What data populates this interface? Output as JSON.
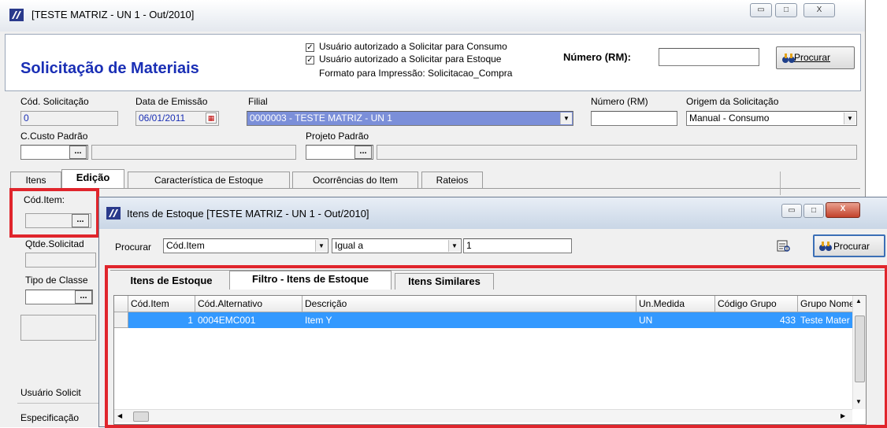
{
  "main_window": {
    "title": "[TESTE MATRIZ - UN 1 - Out/2010]",
    "caption_buttons": {
      "minimize": "▭",
      "maximize": "□",
      "close": "X"
    }
  },
  "header": {
    "title": "Solicitação de Materiais",
    "check1": "Usuário autorizado a Solicitar para Consumo",
    "check2": "Usuário autorizado a Solicitar para Estoque",
    "format_text": "Formato para Impressão: Solicitacao_Compra",
    "numero_rm_label": "Número (RM):",
    "numero_rm_value": "",
    "procurar_label": "Procurar"
  },
  "form": {
    "cod_solicitacao_label": "Cód. Solicitação",
    "cod_solicitacao_value": "0",
    "data_emissao_label": "Data de Emissão",
    "data_emissao_value": "06/01/2011",
    "filial_label": "Filial",
    "filial_value": "0000003 - TESTE MATRIZ - UN 1",
    "numero_rm_label": "Número (RM)",
    "origem_label": "Origem da Solicitação",
    "origem_value": "Manual - Consumo",
    "ccusto_label": "C.Custo Padrão",
    "projeto_label": "Projeto Padrão"
  },
  "tabs": [
    {
      "label": "Itens"
    },
    {
      "label": "Edição"
    },
    {
      "label": "Característica de Estoque"
    },
    {
      "label": "Ocorrências do Item"
    },
    {
      "label": "Rateios"
    }
  ],
  "left_panel": {
    "cod_item_label": "Cód.Item:",
    "qtde_label": "Qtde.Solicitad",
    "tipo_classe_label": "Tipo de Classe",
    "usuario_label": "Usuário Solicit",
    "especificacao_label": "Especificação"
  },
  "child_window": {
    "title": "Itens de Estoque [TESTE MATRIZ - UN 1 - Out/2010]",
    "procurar_label": "Procurar",
    "field_value": "Cód.Item",
    "operator_value": "Igual a",
    "search_value": "1",
    "procurar_button": "Procurar",
    "tabs": [
      {
        "label": "Itens de Estoque"
      },
      {
        "label": "Filtro - Itens de Estoque"
      },
      {
        "label": "Itens Similares"
      }
    ],
    "columns": [
      "Cód.Item",
      "Cód.Alternativo",
      "Descrição",
      "Un.Medida",
      "Código Grupo",
      "Grupo Nome"
    ],
    "rows": [
      [
        "1",
        "0004EMC001",
        "Item Y",
        "UN",
        "433",
        "Teste Mater"
      ]
    ]
  },
  "colors": {
    "title_blue": "#1a2fb5",
    "selection_blue": "#3399ff",
    "highlight_red": "#e0252c"
  },
  "icons": [
    "app-logo-icon",
    "calendar-icon",
    "binoculars-icon",
    "print-preview-icon",
    "dropdown-arrow-icon",
    "ellipsis-icon"
  ]
}
